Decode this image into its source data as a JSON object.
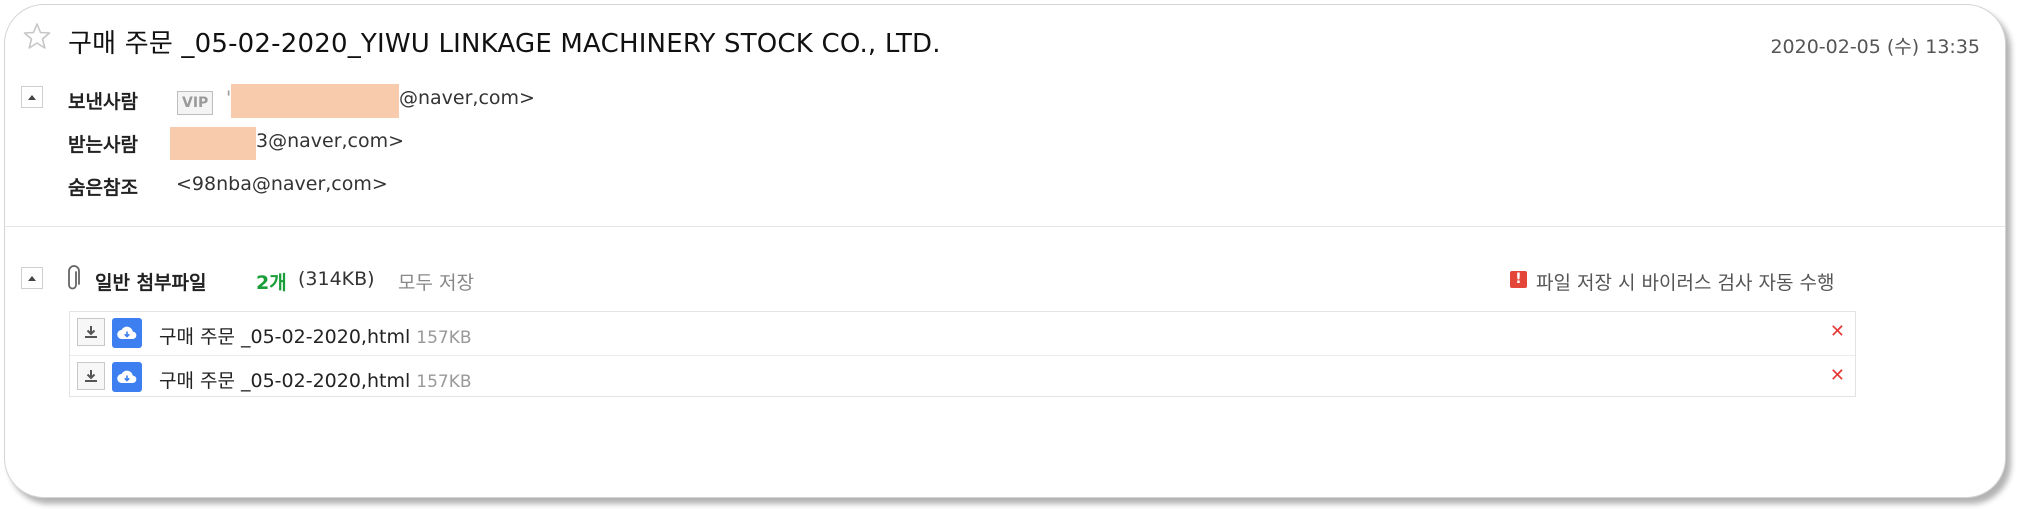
{
  "mail": {
    "subject": "구매 주문 _05-02-2020_YIWU LINKAGE MACHINERY STOCK CO., LTD.",
    "date": "2020-02-05 (수) 13:35"
  },
  "header": {
    "sender_label": "보낸사람",
    "vip_badge": "VIP",
    "sender_prefix": "'",
    "sender_suffix": "@naver,com>",
    "recipient_label": "받는사람",
    "recipient_suffix": "3@naver,com>",
    "bcc_label": "숨은참조",
    "bcc_value": "<98nba@naver,com>"
  },
  "attachments": {
    "label": "일반 첨부파일",
    "count": "2개",
    "total_size": "(314KB)",
    "save_all": "모두 저장",
    "notice": "파일 저장 시 바이러스 검사 자동 수행",
    "notice_icon": "!",
    "files": [
      {
        "name": "구매 주문 _05-02-2020,html",
        "size": "157KB"
      },
      {
        "name": "구매 주문 _05-02-2020,html",
        "size": "157KB"
      }
    ]
  },
  "colors": {
    "accent_green": "#1a9e3a",
    "warning_red": "#e5463a",
    "cloud_blue": "#3d7ef0",
    "redaction": "#f8cbad"
  }
}
